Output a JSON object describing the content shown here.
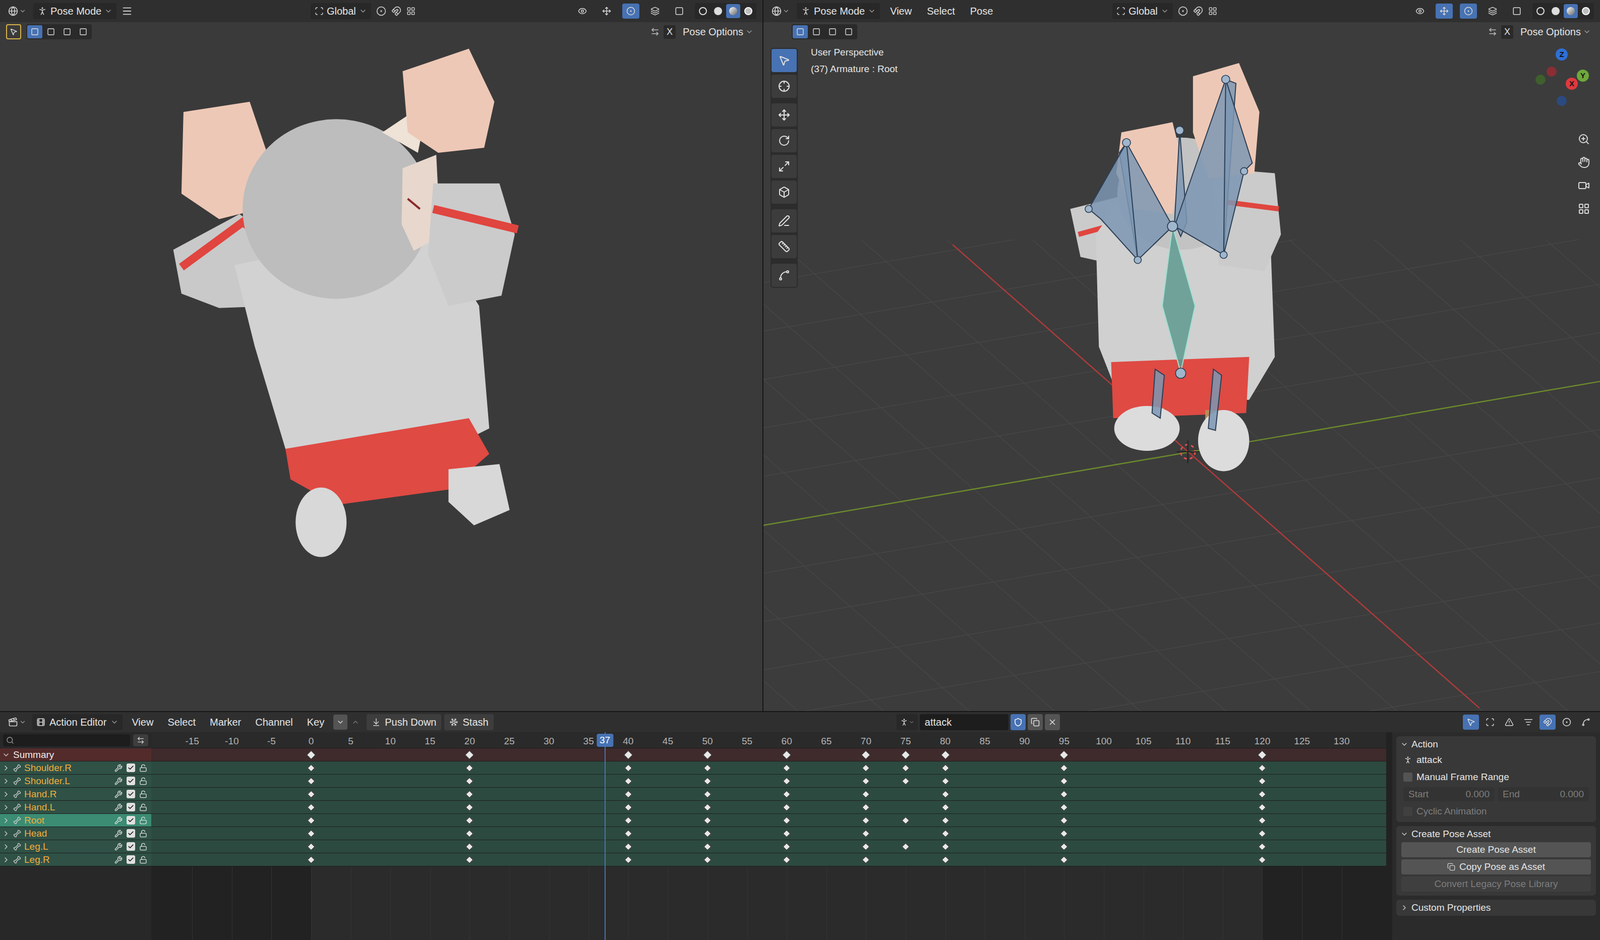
{
  "left_viewport": {
    "mode": "Pose Mode",
    "menus": [],
    "collapsed_menu": true,
    "orientation": "Global",
    "options": "Pose Options",
    "mirror": "X",
    "select_tool": true,
    "select_modes": [
      {
        "selected": true
      },
      {
        "selected": false
      },
      {
        "selected": false
      },
      {
        "selected": false
      }
    ],
    "toggles": [
      {
        "selected": false
      },
      {
        "selected": false
      },
      {
        "selected": true
      },
      {
        "selected": false
      },
      {
        "selected": false
      }
    ],
    "shading": [
      {
        "selected": false
      },
      {
        "selected": false
      },
      {
        "selected": true
      },
      {
        "selected": false
      }
    ]
  },
  "right_viewport": {
    "mode": "Pose Mode",
    "menus": [
      "View",
      "Select",
      "Pose"
    ],
    "collapsed_menu": false,
    "orientation": "Global",
    "options": "Pose Options",
    "mirror": "X",
    "select_tool": false,
    "select_modes": [
      {
        "selected": true
      },
      {
        "selected": false
      },
      {
        "selected": false
      },
      {
        "selected": false
      }
    ],
    "toggles": [
      {
        "selected": false
      },
      {
        "selected": true
      },
      {
        "selected": true
      },
      {
        "selected": false
      },
      {
        "selected": false
      }
    ],
    "shading": [
      {
        "selected": false
      },
      {
        "selected": false
      },
      {
        "selected": true
      },
      {
        "selected": false
      }
    ],
    "overlay": [
      "User Perspective",
      "(37) Armature : Root"
    ],
    "gizmo": {
      "axes": [
        {
          "label": "Z",
          "color": "#2f6fd6"
        },
        {
          "label": "Y",
          "color": "#6fa83a"
        },
        {
          "label": "X",
          "color": "#e0393e"
        }
      ],
      "negative_axes": [
        {
          "color": "#3f5f2c"
        },
        {
          "color": "#8a2e33"
        },
        {
          "color": "#2b4a80"
        }
      ]
    },
    "tools": [
      {
        "kind": "select",
        "selected": true
      },
      {
        "kind": "cursor",
        "selected": false
      },
      {
        "kind": "move",
        "selected": false
      },
      {
        "kind": "rotate",
        "selected": false
      },
      {
        "kind": "scale",
        "selected": false
      },
      {
        "kind": "transform",
        "selected": false
      },
      {
        "kind": "annotate",
        "selected": false
      },
      {
        "kind": "measure",
        "selected": false
      },
      {
        "kind": "bendy",
        "selected": false
      }
    ]
  },
  "action_editor": {
    "editor": "Action Editor",
    "menus": [
      "View",
      "Select",
      "Marker",
      "Channel",
      "Key"
    ],
    "buttons": [
      "Push Down",
      "Stash"
    ],
    "action": "attack",
    "fake_user": true,
    "filters": [
      {
        "selected": true
      },
      {
        "selected": false
      },
      {
        "selected": false
      },
      {
        "selected": false
      },
      {
        "selected": true
      },
      {
        "selected": false
      },
      {
        "selected": false
      }
    ],
    "ruler": [
      "-15",
      "-10",
      "-5",
      "0",
      "5",
      "10",
      "15",
      "20",
      "25",
      "30",
      "35",
      "40",
      "45",
      "50",
      "55",
      "60",
      "65",
      "70",
      "75",
      "80",
      "85",
      "90",
      "95",
      "100",
      "105",
      "110",
      "115",
      "120",
      "125",
      "130"
    ],
    "current_frame": "37",
    "channels": [
      {
        "name": "Summary",
        "kind": "summary",
        "expanded": true,
        "selected": false,
        "enabled": true,
        "keys": [
          0,
          20,
          40,
          50,
          60,
          70,
          75,
          80,
          95,
          120
        ]
      },
      {
        "name": "Shoulder.R",
        "kind": "bone",
        "expanded": false,
        "selected": false,
        "enabled": true,
        "keys": [
          0,
          20,
          40,
          50,
          60,
          70,
          75,
          80,
          95,
          120
        ]
      },
      {
        "name": "Shoulder.L",
        "kind": "bone",
        "expanded": false,
        "selected": false,
        "enabled": true,
        "keys": [
          0,
          20,
          40,
          50,
          60,
          70,
          75,
          80,
          95,
          120
        ]
      },
      {
        "name": "Hand.R",
        "kind": "bone",
        "expanded": false,
        "selected": false,
        "enabled": true,
        "keys": [
          0,
          20,
          40,
          50,
          60,
          70,
          80,
          95,
          120
        ]
      },
      {
        "name": "Hand.L",
        "kind": "bone",
        "expanded": false,
        "selected": false,
        "enabled": true,
        "keys": [
          0,
          20,
          40,
          50,
          60,
          70,
          80,
          95,
          120
        ]
      },
      {
        "name": "Root",
        "kind": "bone",
        "expanded": false,
        "selected": true,
        "enabled": true,
        "keys": [
          0,
          20,
          40,
          50,
          60,
          70,
          75,
          80,
          95,
          120
        ]
      },
      {
        "name": "Head",
        "kind": "bone",
        "expanded": false,
        "selected": false,
        "enabled": true,
        "keys": [
          0,
          20,
          40,
          50,
          60,
          70,
          80,
          95,
          120
        ]
      },
      {
        "name": "Leg.L",
        "kind": "bone",
        "expanded": false,
        "selected": false,
        "enabled": true,
        "keys": [
          0,
          20,
          40,
          50,
          60,
          70,
          75,
          80,
          95,
          120
        ]
      },
      {
        "name": "Leg.R",
        "kind": "bone",
        "expanded": false,
        "selected": false,
        "enabled": true,
        "keys": [
          0,
          20,
          40,
          50,
          60,
          70,
          80,
          95,
          120
        ]
      }
    ]
  },
  "sidebar": {
    "action_panel": {
      "title": "Action",
      "expanded": true,
      "action": "attack",
      "manual_range": {
        "label": "Manual Frame Range",
        "checked": false
      },
      "start": {
        "label": "Start",
        "value": "0.000",
        "disabled": true
      },
      "end": {
        "label": "End",
        "value": "0.000",
        "disabled": true
      },
      "cyclic": {
        "label": "Cyclic Animation",
        "checked": false,
        "disabled": true
      }
    },
    "pose_panel": {
      "title": "Create Pose Asset",
      "expanded": true,
      "buttons": [
        {
          "label": "Create Pose Asset",
          "disabled": false,
          "kind": "plain"
        },
        {
          "label": "Copy Pose as Asset",
          "disabled": false,
          "kind": "icon"
        },
        {
          "label": "Convert Legacy Pose Library",
          "disabled": true,
          "kind": "plain"
        }
      ]
    },
    "custom_panel": {
      "title": "Custom Properties",
      "expanded": false
    }
  }
}
